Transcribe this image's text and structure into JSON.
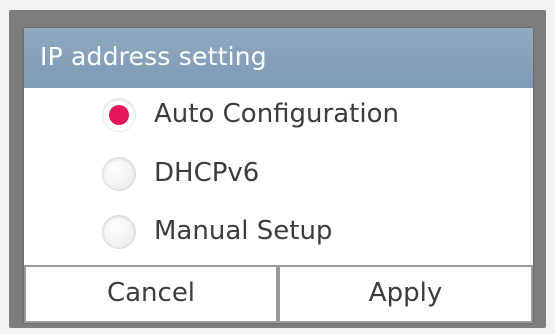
{
  "dialog": {
    "title": "IP address setting",
    "options": [
      {
        "label": "Auto Configuration",
        "selected": true
      },
      {
        "label": "DHCPv6",
        "selected": false
      },
      {
        "label": "Manual Setup",
        "selected": false
      }
    ],
    "buttons": {
      "cancel_label": "Cancel",
      "apply_label": "Apply"
    }
  },
  "colors": {
    "title_bar": "#8aa4bd",
    "selected_radio": "#e3175a",
    "text": "#3c3c3c",
    "title_text": "#ffffff"
  }
}
